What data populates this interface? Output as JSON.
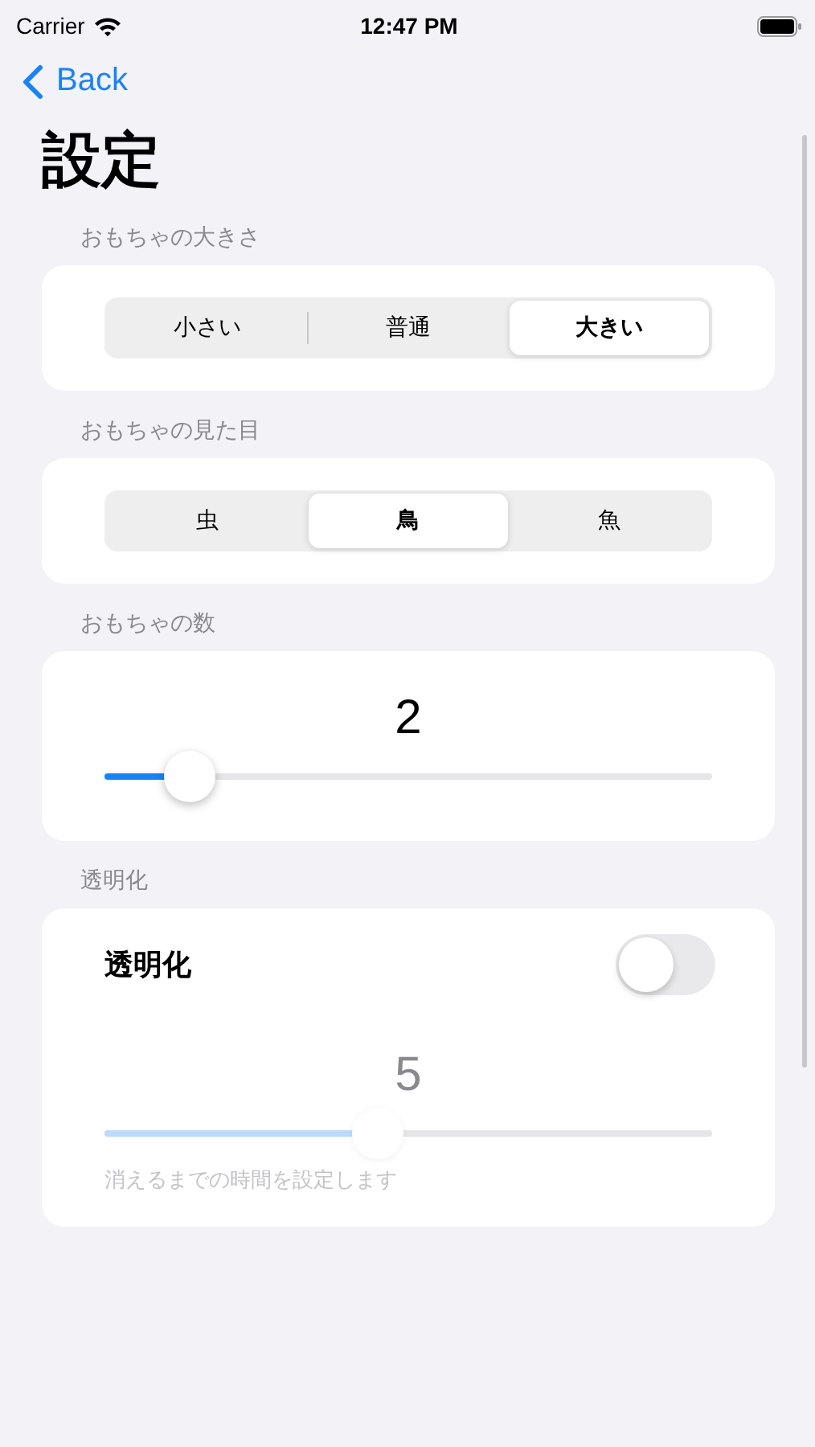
{
  "status_bar": {
    "carrier": "Carrier",
    "time": "12:47 PM"
  },
  "nav": {
    "back_label": "Back"
  },
  "title": "設定",
  "sections": [
    {
      "header": "おもちゃの大きさ",
      "kind": "segmented",
      "segments": [
        {
          "label": "小さい",
          "selected": false
        },
        {
          "label": "普通",
          "selected": false
        },
        {
          "label": "大きい",
          "selected": true
        }
      ]
    },
    {
      "header": "おもちゃの見た目",
      "kind": "segmented",
      "segments": [
        {
          "label": "虫",
          "selected": false
        },
        {
          "label": "鳥",
          "selected": true
        },
        {
          "label": "魚",
          "selected": false
        }
      ]
    },
    {
      "header": "おもちゃの数",
      "kind": "slider",
      "value_text": "2",
      "level": 0.14,
      "disabled": false
    },
    {
      "header": "透明化",
      "kind": "toggle_slider",
      "toggle_label": "透明化",
      "on": false,
      "value_text": "5",
      "level": 0.45,
      "disabled": true,
      "caption": "消えるまでの時間を設定します"
    }
  ]
}
